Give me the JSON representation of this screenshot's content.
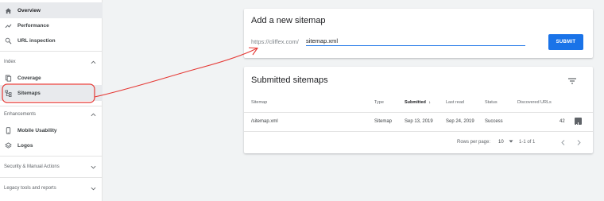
{
  "sidebar": {
    "items": [
      {
        "label": "Overview",
        "icon": "home-icon"
      },
      {
        "label": "Performance",
        "icon": "trending-icon"
      },
      {
        "label": "URL inspection",
        "icon": "search-icon"
      }
    ],
    "index": {
      "title": "Index",
      "items": [
        {
          "label": "Coverage",
          "icon": "coverage-icon"
        },
        {
          "label": "Sitemaps",
          "icon": "sitemap-icon"
        }
      ]
    },
    "enhancements": {
      "title": "Enhancements",
      "items": [
        {
          "label": "Mobile Usability",
          "icon": "phone-icon"
        },
        {
          "label": "Logos",
          "icon": "logo-icon"
        }
      ]
    },
    "security": {
      "title": "Security & Manual Actions"
    },
    "legacy": {
      "title": "Legacy tools and reports"
    }
  },
  "add_sitemap": {
    "title": "Add a new sitemap",
    "url_prefix": "https://cliffex.com/",
    "input_value": "sitemap.xml",
    "submit_label": "SUBMIT"
  },
  "submitted": {
    "title": "Submitted sitemaps",
    "columns": {
      "sitemap": "Sitemap",
      "type": "Type",
      "submitted": "Submitted",
      "sort_arrow": "↓",
      "last_read": "Last read",
      "status": "Status",
      "discovered": "Discovered URLs"
    },
    "rows": [
      {
        "sitemap": "/sitemap.xml",
        "type": "Sitemap",
        "submitted": "Sep 13, 2019",
        "last_read": "Sep 24, 2019",
        "status": "Success",
        "discovered": "42"
      }
    ],
    "pagination": {
      "rows_per_page_label": "Rows per page:",
      "rows_per_page_value": "10",
      "range": "1-1 of 1"
    }
  },
  "colors": {
    "accent": "#1a73e8",
    "annotation": "#e53935"
  }
}
